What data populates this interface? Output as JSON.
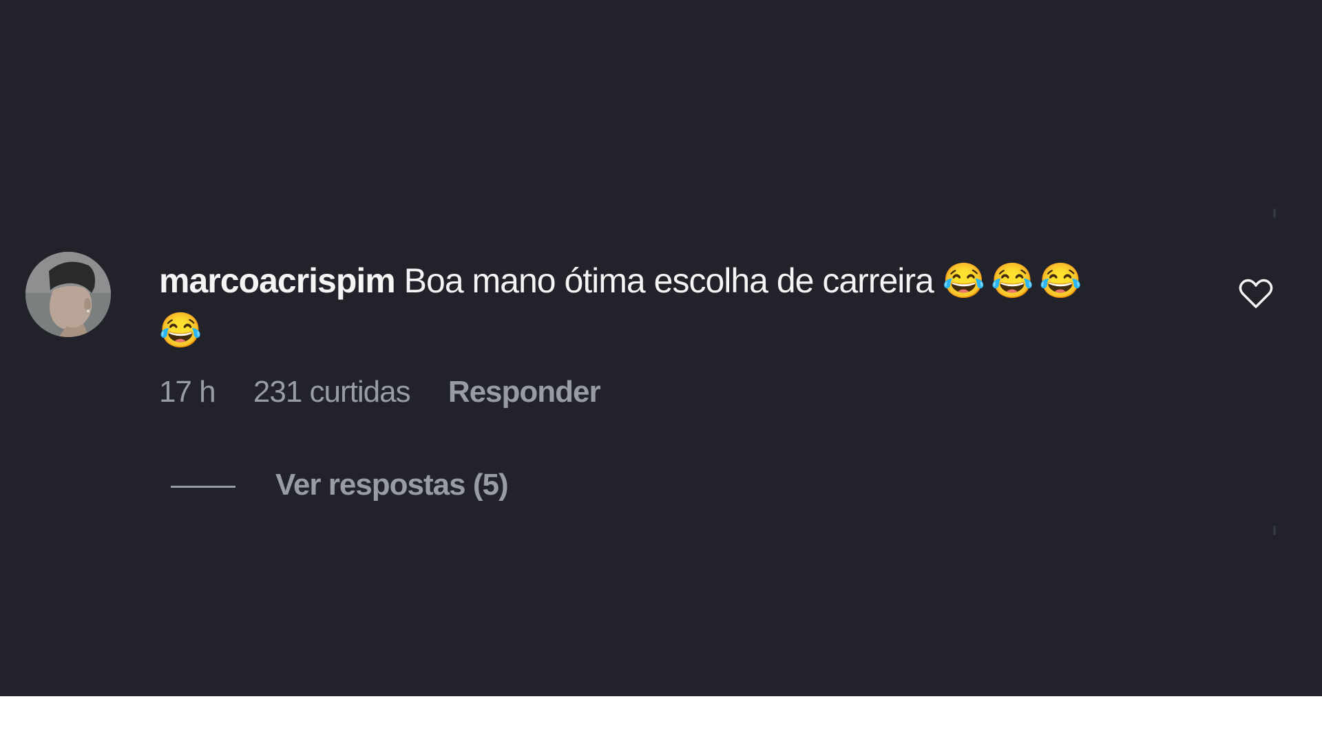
{
  "comment": {
    "username": "marcoacrispim",
    "text": "Boa mano ótima escolha de carreira",
    "emoji_line1": "😂😂😂",
    "emoji_line2": "😂",
    "time": "17 h",
    "likes": "231 curtidas",
    "reply_label": "Responder",
    "view_replies_label": "Ver respostas (5)"
  },
  "icons": {
    "like": "heart-outline-icon",
    "avatar": "user-avatar"
  },
  "colors": {
    "background": "#22232a",
    "primary_text": "#f5f5f5",
    "secondary_text": "#9a9ca3",
    "page_below": "#ffffff"
  }
}
